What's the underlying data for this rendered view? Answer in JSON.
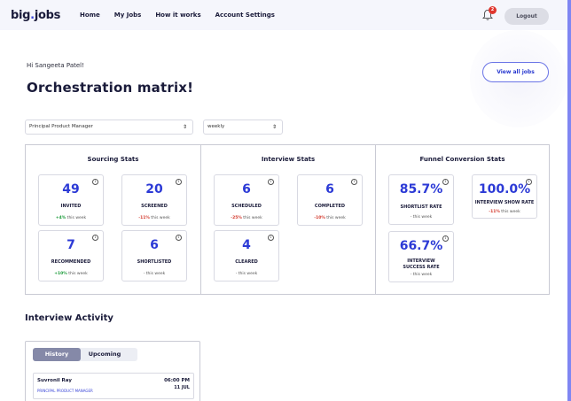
{
  "brand": {
    "logo_main": "big",
    "logo_dot": ".",
    "logo_end": "jobs"
  },
  "nav": {
    "items": [
      "Home",
      "My Jobs",
      "How it works",
      "Account Settings"
    ],
    "logout": "Logout",
    "notification_count": "2"
  },
  "header": {
    "greeting": "Hi Sangeeta Patel!",
    "title": "Orchestration matrix!",
    "view_all": "View all jobs"
  },
  "filters": {
    "role": "Principal Product Manager",
    "period": "weekly"
  },
  "sourcing": {
    "title": "Sourcing Stats",
    "cards": [
      {
        "value": "49",
        "label": "INVITED",
        "change": "+4%",
        "suffix": " this week",
        "trend": "pos"
      },
      {
        "value": "20",
        "label": "SCREENED",
        "change": "-11%",
        "suffix": " this week",
        "trend": "neg"
      },
      {
        "value": "7",
        "label": "RECOMMENDED",
        "change": "+10%",
        "suffix": " this week",
        "trend": "pos"
      },
      {
        "value": "6",
        "label": "SHORTLISTED",
        "change": "",
        "suffix": "- this week",
        "trend": "none"
      }
    ]
  },
  "interview": {
    "title": "Interview Stats",
    "cards": [
      {
        "value": "6",
        "label": "SCHEDULED",
        "change": "-25%",
        "suffix": " this week",
        "trend": "neg"
      },
      {
        "value": "6",
        "label": "COMPLETED",
        "change": "-10%",
        "suffix": " this week",
        "trend": "neg"
      },
      {
        "value": "4",
        "label": "CLEARED",
        "change": "",
        "suffix": "- this week",
        "trend": "none"
      }
    ]
  },
  "funnel": {
    "title": "Funnel Conversion Stats",
    "cards": [
      {
        "value": "85.7%",
        "label": "SHORTLIST RATE",
        "change": "",
        "suffix": "- this week",
        "trend": "none"
      },
      {
        "value": "100.0%",
        "label": "INTERVIEW SHOW RATE",
        "change": "-11%",
        "suffix": " this week",
        "trend": "neg"
      },
      {
        "value": "66.7%",
        "label": "INTERVIEW SUCCESS RATE",
        "change": "",
        "suffix": "- this week",
        "trend": "none"
      }
    ]
  },
  "activity": {
    "title": "Interview Activity",
    "tabs": [
      "History",
      "Upcoming"
    ],
    "entries": [
      {
        "name": "Suvronil Ray",
        "role": "PRINCIPAL PRODUCT MANAGER",
        "time": "06:00 PM",
        "date": "11 JUL"
      }
    ]
  },
  "colors": {
    "accent": "#2c3ad6",
    "positive": "#1c9b3a",
    "negative": "#d33a2e",
    "frame": "#7f86f2"
  }
}
